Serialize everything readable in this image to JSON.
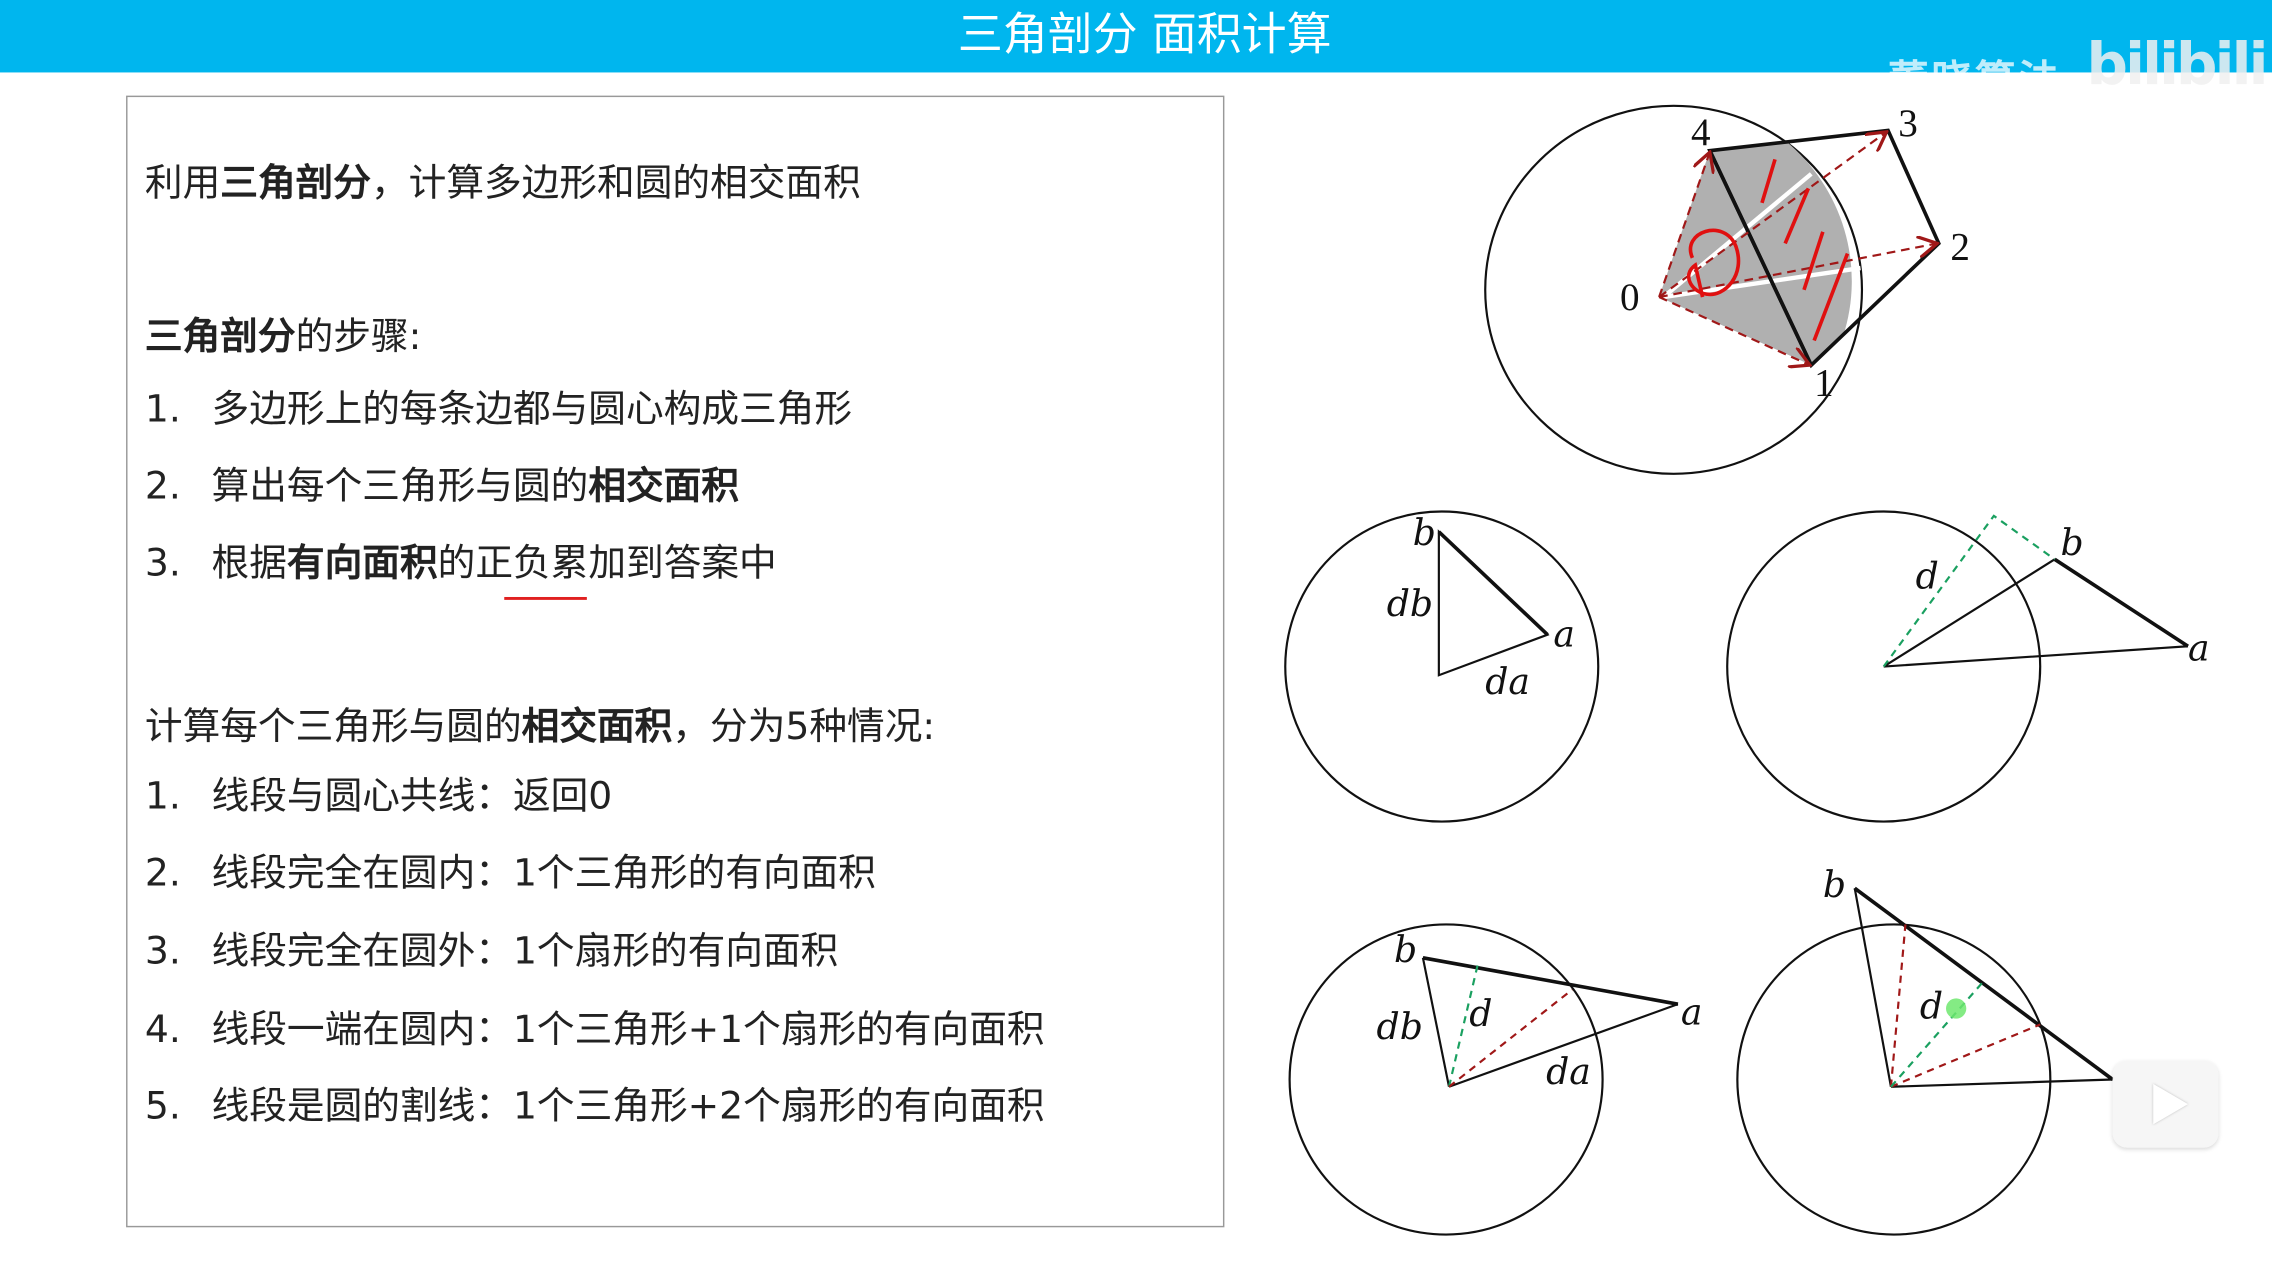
{
  "header": {
    "title": "三角剖分 面积计算",
    "watermark_text": "董晓算法",
    "watermark_logo": "bilibili",
    "color": "#00b6ee"
  },
  "intro": {
    "pre": "利用",
    "bold": "三角剖分",
    "post": "，计算多边形和圆的相交面积"
  },
  "steps": {
    "heading_bold": "三角剖分",
    "heading_rest": "的步骤:",
    "items": [
      {
        "num": "1.",
        "pre": "多边形上的每条边都与圆心构成三角形",
        "bold": "",
        "post": ""
      },
      {
        "num": "2.",
        "pre": "算出每个三角形与圆的",
        "bold": "相交面积",
        "post": ""
      },
      {
        "num": "3.",
        "pre": "根据",
        "bold": "有向面积",
        "post": "的正负累加到答案中"
      }
    ]
  },
  "cases": {
    "heading_pre": "计算每个三角形与圆的",
    "heading_bold": "相交面积",
    "heading_post": "，分为5种情况:",
    "items": [
      {
        "num": "1.",
        "text": "线段与圆心共线：返回0"
      },
      {
        "num": "2.",
        "text": "线段完全在圆内：1个三角形的有向面积"
      },
      {
        "num": "3.",
        "text": "线段完全在圆外：1个扇形的有向面积"
      },
      {
        "num": "4.",
        "text": "线段一端在圆内：1个三角形+1个扇形的有向面积"
      },
      {
        "num": "5.",
        "text": "线段是圆的割线：1个三角形+2个扇形的有向面积"
      }
    ]
  },
  "diagrams": {
    "polygon_labels": [
      "0",
      "1",
      "2",
      "3",
      "4"
    ],
    "a": "a",
    "b": "b",
    "da": "da",
    "db": "db",
    "d": "d"
  },
  "colors": {
    "shade": "#b0b0b0",
    "red_dash": "#a01818",
    "green_dash": "#1aa060",
    "annotation": "#e01010",
    "highlight": "#6ee86e"
  }
}
